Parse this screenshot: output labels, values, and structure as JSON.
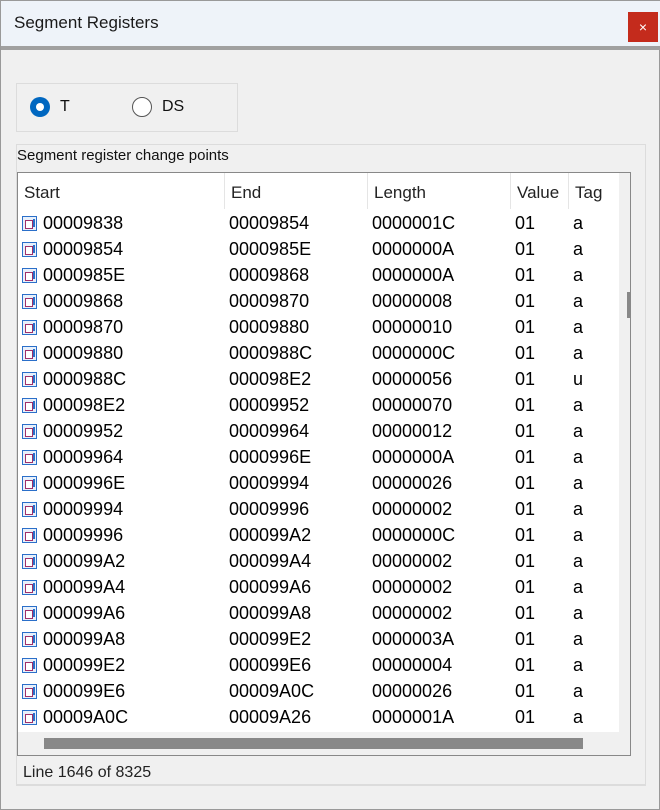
{
  "window": {
    "title": "Segment Registers",
    "close_icon": "×"
  },
  "radios": [
    {
      "label": "T",
      "checked": true
    },
    {
      "label": "DS",
      "checked": false
    }
  ],
  "group_label": "Segment register change points",
  "columns": [
    "Start",
    "End",
    "Length",
    "Value",
    "Tag"
  ],
  "rows": [
    [
      "00009838",
      "00009854",
      "0000001C",
      "01",
      "a"
    ],
    [
      "00009854",
      "0000985E",
      "0000000A",
      "01",
      "a"
    ],
    [
      "0000985E",
      "00009868",
      "0000000A",
      "01",
      "a"
    ],
    [
      "00009868",
      "00009870",
      "00000008",
      "01",
      "a"
    ],
    [
      "00009870",
      "00009880",
      "00000010",
      "01",
      "a"
    ],
    [
      "00009880",
      "0000988C",
      "0000000C",
      "01",
      "a"
    ],
    [
      "0000988C",
      "000098E2",
      "00000056",
      "01",
      "u"
    ],
    [
      "000098E2",
      "00009952",
      "00000070",
      "01",
      "a"
    ],
    [
      "00009952",
      "00009964",
      "00000012",
      "01",
      "a"
    ],
    [
      "00009964",
      "0000996E",
      "0000000A",
      "01",
      "a"
    ],
    [
      "0000996E",
      "00009994",
      "00000026",
      "01",
      "a"
    ],
    [
      "00009994",
      "00009996",
      "00000002",
      "01",
      "a"
    ],
    [
      "00009996",
      "000099A2",
      "0000000C",
      "01",
      "a"
    ],
    [
      "000099A2",
      "000099A4",
      "00000002",
      "01",
      "a"
    ],
    [
      "000099A4",
      "000099A6",
      "00000002",
      "01",
      "a"
    ],
    [
      "000099A6",
      "000099A8",
      "00000002",
      "01",
      "a"
    ],
    [
      "000099A8",
      "000099E2",
      "0000003A",
      "01",
      "a"
    ],
    [
      "000099E2",
      "000099E6",
      "00000004",
      "01",
      "a"
    ],
    [
      "000099E6",
      "00009A0C",
      "00000026",
      "01",
      "a"
    ],
    [
      "00009A0C",
      "00009A26",
      "0000001A",
      "01",
      "a"
    ]
  ],
  "status": "Line 1646 of 8325"
}
